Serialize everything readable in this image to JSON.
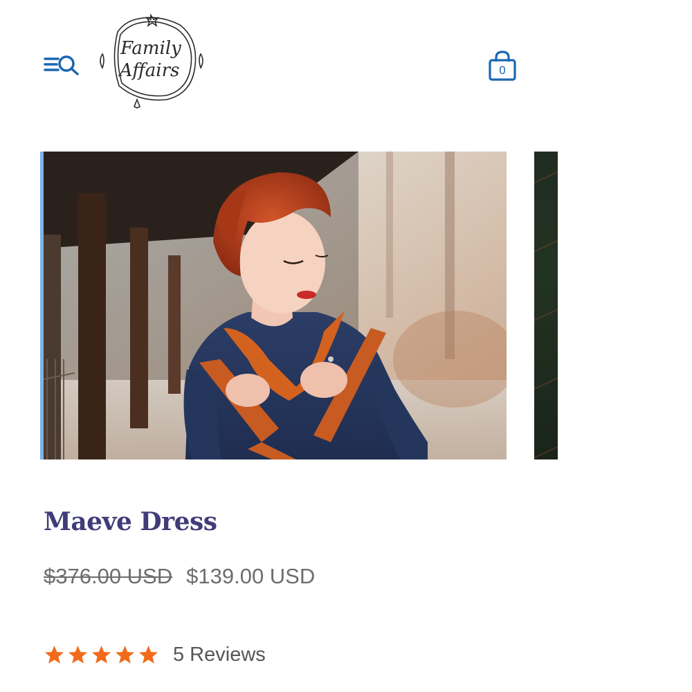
{
  "header": {
    "logo_text_line1": "Family",
    "logo_text_line2": "Affairs",
    "cart_count": "0"
  },
  "product": {
    "title": "Maeve Dress",
    "price_original": "$376.00 USD",
    "price_sale": "$139.00 USD",
    "rating": 5,
    "reviews_label": "5 Reviews"
  },
  "colors": {
    "accent_blue": "#1b66b1",
    "title_purple": "#413c78",
    "star_orange": "#f26a1b",
    "price_gray": "#6d6d6d"
  },
  "icons": [
    "menu-search-icon",
    "shopping-bag-icon",
    "star-icon"
  ]
}
